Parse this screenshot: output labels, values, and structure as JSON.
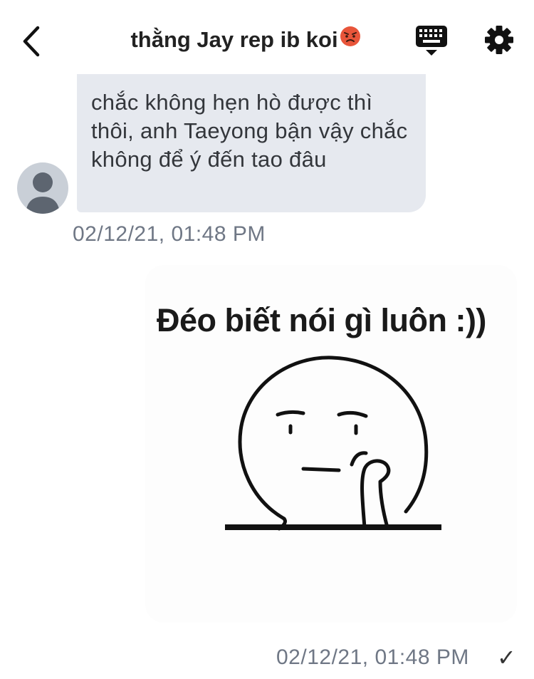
{
  "header": {
    "title": "thằng Jay rep ib koi",
    "title_emoji": "pouting-face-emoji",
    "back_icon": "chevron-left-icon",
    "keyboard_icon": "keyboard-icon",
    "settings_icon": "gear-icon"
  },
  "messages": [
    {
      "direction": "incoming",
      "text": "chắc không hẹn hò được thì thôi, anh Taeyong bận vậy chắc không để ý đến tao đâu",
      "timestamp": "02/12/21, 01:48 PM",
      "avatar_icon": "default-user-avatar"
    },
    {
      "direction": "outgoing",
      "type": "image",
      "caption": "Đéo biết nói gì luôn :))",
      "timestamp": "02/12/21, 01:48 PM",
      "status": "✓"
    }
  ],
  "colors": {
    "incoming_bubble": "#e6e9ef",
    "timestamp": "#6f7785",
    "avatar_bg": "#c9cfd7",
    "avatar_fg": "#5d6570"
  }
}
